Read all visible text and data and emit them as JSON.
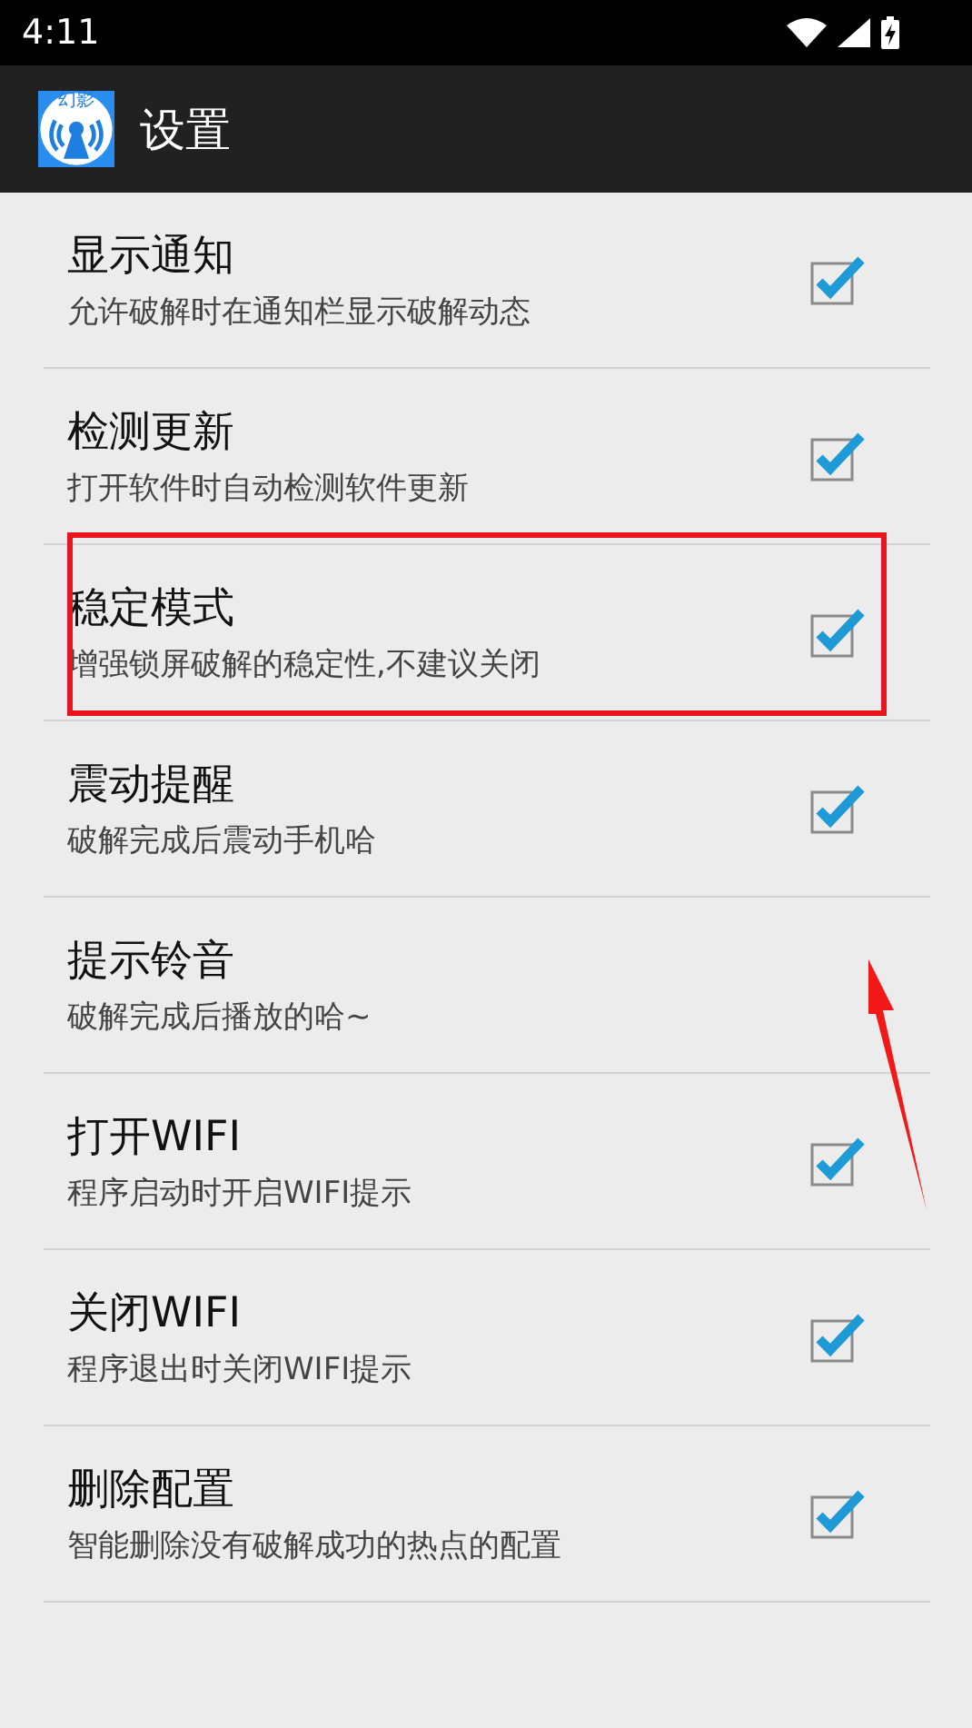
{
  "status_bar": {
    "time": "4:11"
  },
  "action_bar": {
    "icon_label": "幻影",
    "title": "设置"
  },
  "items": [
    {
      "title": "显示通知",
      "summary": "允许破解时在通知栏显示破解动态",
      "checked": true,
      "highlighted": false
    },
    {
      "title": "检测更新",
      "summary": "打开软件时自动检测软件更新",
      "checked": true,
      "highlighted": false
    },
    {
      "title": "稳定模式",
      "summary": "增强锁屏破解的稳定性,不建议关闭",
      "checked": true,
      "highlighted": true
    },
    {
      "title": "震动提醒",
      "summary": "破解完成后震动手机哈",
      "checked": true,
      "highlighted": false
    },
    {
      "title": "提示铃音",
      "summary": "破解完成后播放的哈~",
      "checked": false,
      "highlighted": false
    },
    {
      "title": "打开WIFI",
      "summary": "程序启动时开启WIFI提示",
      "checked": true,
      "highlighted": false
    },
    {
      "title": "关闭WIFI",
      "summary": "程序退出时关闭WIFI提示",
      "checked": true,
      "highlighted": false
    },
    {
      "title": "删除配置",
      "summary": "智能删除没有破解成功的热点的配置",
      "checked": true,
      "highlighted": false
    }
  ],
  "annotation_arrow": true
}
